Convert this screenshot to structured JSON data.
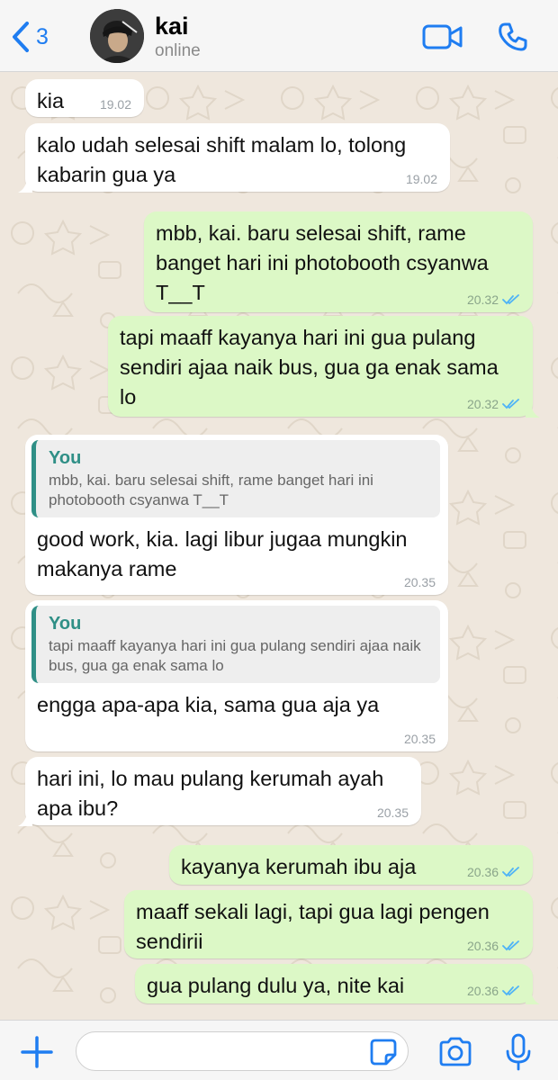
{
  "header": {
    "back_count": "3",
    "contact_name": "kai",
    "contact_status": "online"
  },
  "messages": [
    {
      "dir": "in",
      "text": "kia",
      "time": "19.02"
    },
    {
      "dir": "in",
      "text": "kalo udah selesai shift malam lo, tolong kabarin gua ya",
      "time": "19.02"
    },
    {
      "dir": "out",
      "text": "mbb, kai. baru selesai shift, rame banget hari ini photobooth csyanwa T__T",
      "time": "20.32",
      "status": "read"
    },
    {
      "dir": "out",
      "text": "tapi maaff kayanya hari ini gua pulang sendiri ajaa naik bus, gua ga enak sama lo",
      "time": "20.32",
      "status": "read"
    },
    {
      "dir": "in",
      "quote_author": "You",
      "quote_text": "mbb, kai. baru selesai shift, rame banget hari ini photobooth csyanwa T__T",
      "text": "good work, kia. lagi libur jugaa mungkin makanya rame",
      "time": "20.35"
    },
    {
      "dir": "in",
      "quote_author": "You",
      "quote_text": "tapi maaff kayanya hari ini gua pulang sendiri ajaa naik bus, gua ga enak sama lo",
      "text": "engga apa-apa kia, sama gua aja ya",
      "time": "20.35"
    },
    {
      "dir": "in",
      "text": "hari ini, lo mau pulang kerumah ayah apa ibu?",
      "time": "20.35"
    },
    {
      "dir": "out",
      "text": "kayanya kerumah ibu aja",
      "time": "20.36",
      "status": "read"
    },
    {
      "dir": "out",
      "text": "maaff sekali lagi, tapi gua lagi pengen sendirii",
      "time": "20.36",
      "status": "read"
    },
    {
      "dir": "out",
      "text": "gua pulang dulu ya, nite kai",
      "time": "20.36",
      "status": "read"
    }
  ],
  "composer": {
    "input_value": "",
    "input_placeholder": ""
  },
  "colors": {
    "accent": "#1f7df1",
    "incoming_bubble": "#ffffff",
    "outgoing_bubble": "#dcf8c6",
    "quote_accent": "#2f8f86",
    "read_tick": "#4fb3f6",
    "wallpaper": "#efe7dd"
  },
  "icons": {
    "back": "chevron-left-icon",
    "video": "video-call-icon",
    "phone": "phone-call-icon",
    "plus": "plus-icon",
    "sticker": "sticker-icon",
    "camera": "camera-icon",
    "mic": "microphone-icon",
    "read_receipt": "double-check-icon"
  }
}
